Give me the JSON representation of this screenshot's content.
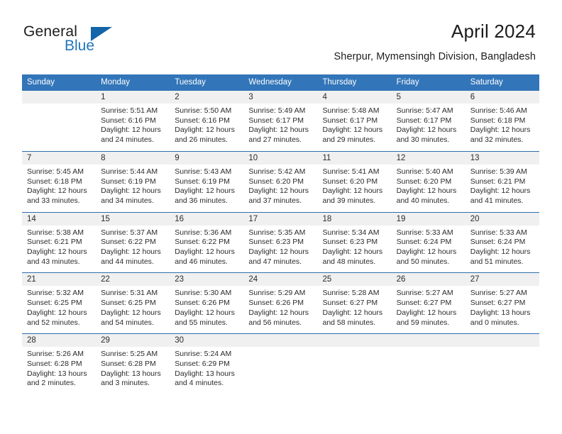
{
  "brand": {
    "word_one": "General",
    "word_two": "Blue",
    "logo_icon": "triangle-logo-icon",
    "accent_color": "#1364a8",
    "blue_text_color": "#2176bd"
  },
  "header": {
    "title": "April 2024",
    "location": "Sherpur, Mymensingh Division, Bangladesh"
  },
  "calendar": {
    "header_bg": "#3275b9",
    "header_text_color": "#ffffff",
    "daynum_bg": "#f0f0f0",
    "separator_color": "#2f6fae",
    "weekdays": [
      "Sunday",
      "Monday",
      "Tuesday",
      "Wednesday",
      "Thursday",
      "Friday",
      "Saturday"
    ],
    "weeks": [
      [
        {
          "day": "",
          "sunrise": "",
          "sunset": "",
          "daylight_1": "",
          "daylight_2": ""
        },
        {
          "day": "1",
          "sunrise": "Sunrise: 5:51 AM",
          "sunset": "Sunset: 6:16 PM",
          "daylight_1": "Daylight: 12 hours",
          "daylight_2": "and 24 minutes."
        },
        {
          "day": "2",
          "sunrise": "Sunrise: 5:50 AM",
          "sunset": "Sunset: 6:16 PM",
          "daylight_1": "Daylight: 12 hours",
          "daylight_2": "and 26 minutes."
        },
        {
          "day": "3",
          "sunrise": "Sunrise: 5:49 AM",
          "sunset": "Sunset: 6:17 PM",
          "daylight_1": "Daylight: 12 hours",
          "daylight_2": "and 27 minutes."
        },
        {
          "day": "4",
          "sunrise": "Sunrise: 5:48 AM",
          "sunset": "Sunset: 6:17 PM",
          "daylight_1": "Daylight: 12 hours",
          "daylight_2": "and 29 minutes."
        },
        {
          "day": "5",
          "sunrise": "Sunrise: 5:47 AM",
          "sunset": "Sunset: 6:17 PM",
          "daylight_1": "Daylight: 12 hours",
          "daylight_2": "and 30 minutes."
        },
        {
          "day": "6",
          "sunrise": "Sunrise: 5:46 AM",
          "sunset": "Sunset: 6:18 PM",
          "daylight_1": "Daylight: 12 hours",
          "daylight_2": "and 32 minutes."
        }
      ],
      [
        {
          "day": "7",
          "sunrise": "Sunrise: 5:45 AM",
          "sunset": "Sunset: 6:18 PM",
          "daylight_1": "Daylight: 12 hours",
          "daylight_2": "and 33 minutes."
        },
        {
          "day": "8",
          "sunrise": "Sunrise: 5:44 AM",
          "sunset": "Sunset: 6:19 PM",
          "daylight_1": "Daylight: 12 hours",
          "daylight_2": "and 34 minutes."
        },
        {
          "day": "9",
          "sunrise": "Sunrise: 5:43 AM",
          "sunset": "Sunset: 6:19 PM",
          "daylight_1": "Daylight: 12 hours",
          "daylight_2": "and 36 minutes."
        },
        {
          "day": "10",
          "sunrise": "Sunrise: 5:42 AM",
          "sunset": "Sunset: 6:20 PM",
          "daylight_1": "Daylight: 12 hours",
          "daylight_2": "and 37 minutes."
        },
        {
          "day": "11",
          "sunrise": "Sunrise: 5:41 AM",
          "sunset": "Sunset: 6:20 PM",
          "daylight_1": "Daylight: 12 hours",
          "daylight_2": "and 39 minutes."
        },
        {
          "day": "12",
          "sunrise": "Sunrise: 5:40 AM",
          "sunset": "Sunset: 6:20 PM",
          "daylight_1": "Daylight: 12 hours",
          "daylight_2": "and 40 minutes."
        },
        {
          "day": "13",
          "sunrise": "Sunrise: 5:39 AM",
          "sunset": "Sunset: 6:21 PM",
          "daylight_1": "Daylight: 12 hours",
          "daylight_2": "and 41 minutes."
        }
      ],
      [
        {
          "day": "14",
          "sunrise": "Sunrise: 5:38 AM",
          "sunset": "Sunset: 6:21 PM",
          "daylight_1": "Daylight: 12 hours",
          "daylight_2": "and 43 minutes."
        },
        {
          "day": "15",
          "sunrise": "Sunrise: 5:37 AM",
          "sunset": "Sunset: 6:22 PM",
          "daylight_1": "Daylight: 12 hours",
          "daylight_2": "and 44 minutes."
        },
        {
          "day": "16",
          "sunrise": "Sunrise: 5:36 AM",
          "sunset": "Sunset: 6:22 PM",
          "daylight_1": "Daylight: 12 hours",
          "daylight_2": "and 46 minutes."
        },
        {
          "day": "17",
          "sunrise": "Sunrise: 5:35 AM",
          "sunset": "Sunset: 6:23 PM",
          "daylight_1": "Daylight: 12 hours",
          "daylight_2": "and 47 minutes."
        },
        {
          "day": "18",
          "sunrise": "Sunrise: 5:34 AM",
          "sunset": "Sunset: 6:23 PM",
          "daylight_1": "Daylight: 12 hours",
          "daylight_2": "and 48 minutes."
        },
        {
          "day": "19",
          "sunrise": "Sunrise: 5:33 AM",
          "sunset": "Sunset: 6:24 PM",
          "daylight_1": "Daylight: 12 hours",
          "daylight_2": "and 50 minutes."
        },
        {
          "day": "20",
          "sunrise": "Sunrise: 5:33 AM",
          "sunset": "Sunset: 6:24 PM",
          "daylight_1": "Daylight: 12 hours",
          "daylight_2": "and 51 minutes."
        }
      ],
      [
        {
          "day": "21",
          "sunrise": "Sunrise: 5:32 AM",
          "sunset": "Sunset: 6:25 PM",
          "daylight_1": "Daylight: 12 hours",
          "daylight_2": "and 52 minutes."
        },
        {
          "day": "22",
          "sunrise": "Sunrise: 5:31 AM",
          "sunset": "Sunset: 6:25 PM",
          "daylight_1": "Daylight: 12 hours",
          "daylight_2": "and 54 minutes."
        },
        {
          "day": "23",
          "sunrise": "Sunrise: 5:30 AM",
          "sunset": "Sunset: 6:26 PM",
          "daylight_1": "Daylight: 12 hours",
          "daylight_2": "and 55 minutes."
        },
        {
          "day": "24",
          "sunrise": "Sunrise: 5:29 AM",
          "sunset": "Sunset: 6:26 PM",
          "daylight_1": "Daylight: 12 hours",
          "daylight_2": "and 56 minutes."
        },
        {
          "day": "25",
          "sunrise": "Sunrise: 5:28 AM",
          "sunset": "Sunset: 6:27 PM",
          "daylight_1": "Daylight: 12 hours",
          "daylight_2": "and 58 minutes."
        },
        {
          "day": "26",
          "sunrise": "Sunrise: 5:27 AM",
          "sunset": "Sunset: 6:27 PM",
          "daylight_1": "Daylight: 12 hours",
          "daylight_2": "and 59 minutes."
        },
        {
          "day": "27",
          "sunrise": "Sunrise: 5:27 AM",
          "sunset": "Sunset: 6:27 PM",
          "daylight_1": "Daylight: 13 hours",
          "daylight_2": "and 0 minutes."
        }
      ],
      [
        {
          "day": "28",
          "sunrise": "Sunrise: 5:26 AM",
          "sunset": "Sunset: 6:28 PM",
          "daylight_1": "Daylight: 13 hours",
          "daylight_2": "and 2 minutes."
        },
        {
          "day": "29",
          "sunrise": "Sunrise: 5:25 AM",
          "sunset": "Sunset: 6:28 PM",
          "daylight_1": "Daylight: 13 hours",
          "daylight_2": "and 3 minutes."
        },
        {
          "day": "30",
          "sunrise": "Sunrise: 5:24 AM",
          "sunset": "Sunset: 6:29 PM",
          "daylight_1": "Daylight: 13 hours",
          "daylight_2": "and 4 minutes."
        },
        {
          "day": "",
          "sunrise": "",
          "sunset": "",
          "daylight_1": "",
          "daylight_2": ""
        },
        {
          "day": "",
          "sunrise": "",
          "sunset": "",
          "daylight_1": "",
          "daylight_2": ""
        },
        {
          "day": "",
          "sunrise": "",
          "sunset": "",
          "daylight_1": "",
          "daylight_2": ""
        },
        {
          "day": "",
          "sunrise": "",
          "sunset": "",
          "daylight_1": "",
          "daylight_2": ""
        }
      ]
    ]
  }
}
